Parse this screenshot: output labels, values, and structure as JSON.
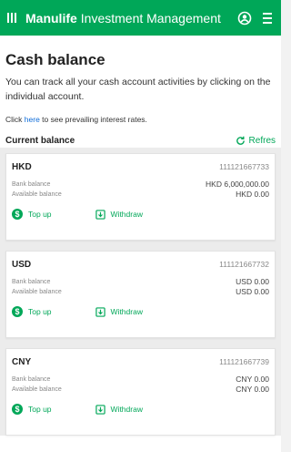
{
  "header": {
    "brand_strong": "Manulife",
    "brand_rest": "Investment Management",
    "user_icon": "user-circle-icon",
    "menu_icon": "hamburger-menu-icon"
  },
  "page": {
    "title": "Cash balance",
    "intro": "You can track all your cash account activities by clicking on the individual account.",
    "interest_prefix": "Click ",
    "interest_link": "here",
    "interest_suffix": " to see prevailing interest rates."
  },
  "balance": {
    "section_title": "Current balance",
    "refresh_label": "Refres"
  },
  "accounts": [
    {
      "currency": "HKD",
      "account_no": "111121667733",
      "bank_label": "Bank balance",
      "bank_value": "HKD 6,000,000.00",
      "available_label": "Available balance",
      "available_value": "HKD 0.00",
      "topup_label": "Top up",
      "withdraw_label": "Withdraw"
    },
    {
      "currency": "USD",
      "account_no": "111121667732",
      "bank_label": "Bank balance",
      "bank_value": "USD 0.00",
      "available_label": "Available balance",
      "available_value": "USD 0.00",
      "topup_label": "Top up",
      "withdraw_label": "Withdraw"
    },
    {
      "currency": "CNY",
      "account_no": "111121667739",
      "bank_label": "Bank balance",
      "bank_value": "CNY 0.00",
      "available_label": "Available balance",
      "available_value": "CNY 0.00",
      "topup_label": "Top up",
      "withdraw_label": "Withdraw"
    }
  ],
  "colors": {
    "brand_green": "#00a758",
    "link_blue": "#0d6bd8"
  }
}
